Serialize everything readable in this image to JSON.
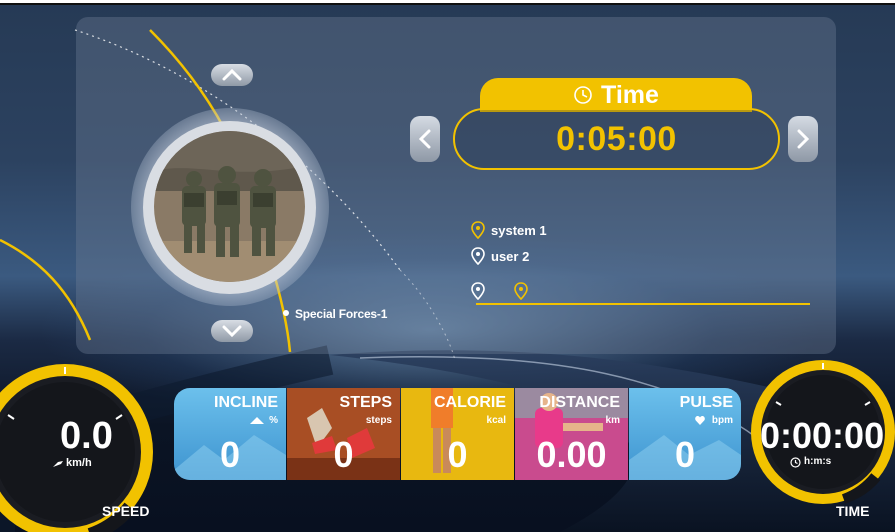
{
  "program": {
    "route_name": "Special Forces-1",
    "photo_icon": "soldiers-photo"
  },
  "time_setting": {
    "title": "Time",
    "value": "0:05:00",
    "prev_icon": "chevron-left-icon",
    "next_icon": "chevron-right-icon"
  },
  "navigation": {
    "up_icon": "chevron-up-icon",
    "down_icon": "chevron-down-icon"
  },
  "legend": {
    "items": [
      {
        "label": "system 1",
        "color": "#f2c200"
      },
      {
        "label": "user 2",
        "color": "#ffffff"
      }
    ]
  },
  "speed": {
    "value": "0.0",
    "unit": "km/h",
    "label": "SPEED"
  },
  "elapsed_time": {
    "value": "0:00:00",
    "unit": "h:m:s",
    "label": "TIME"
  },
  "metrics": [
    {
      "label": "INCLINE",
      "unit": "%",
      "value": "0",
      "color": "#5fb3e0"
    },
    {
      "label": "STEPS",
      "unit": "steps",
      "value": "0",
      "color": "#b85a2a"
    },
    {
      "label": "CALORIE",
      "unit": "kcal",
      "value": "0",
      "color": "#f2c200"
    },
    {
      "label": "DISTANCE",
      "unit": "km",
      "value": "0.00",
      "color": "#d04a9a"
    },
    {
      "label": "PULSE",
      "unit": "bpm",
      "value": "0",
      "color": "#5fb3e0"
    }
  ],
  "colors": {
    "accent": "#f2c200",
    "panel": "#6e7d96"
  }
}
